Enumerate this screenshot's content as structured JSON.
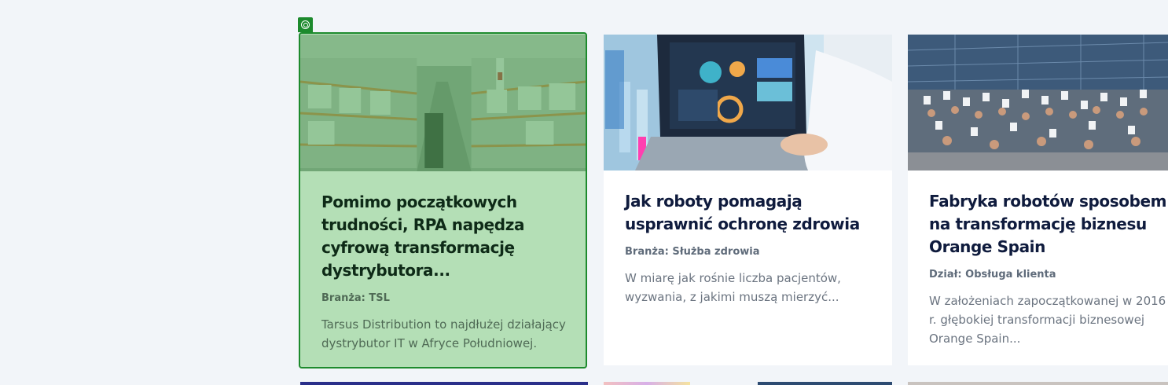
{
  "cards": [
    {
      "title": "Pomimo początkowych\ntrudności, RPA napędza\ncyfrową transformację\ndystrybutora...",
      "meta_label": "Branża:",
      "meta_value": "TSL",
      "excerpt": "Tarsus Distribution to najdłużej działający\ndystrybutor IT w Afryce Południowej.",
      "image": "warehouse-photo"
    },
    {
      "title": "Jak roboty pomagają\nusprawnić ochronę zdrowia",
      "meta_label": "Branża:",
      "meta_value": "Służba zdrowia",
      "excerpt": "W miarę jak rośnie liczba pacjentów,\nwyzwania, z jakimi muszą mierzyć...",
      "image": "laboratory-laptop-photo"
    },
    {
      "title": "Fabryka robotów sposobem\nna transformację biznesu\nOrange Spain",
      "meta_label": "Dział:",
      "meta_value": "Obsługa klienta",
      "excerpt": "W założeniach zapoczątkowanej w 2016\nr. głębokiej transformacji biznesowej\nOrange Spain...",
      "image": "group-photo"
    }
  ],
  "colors": {
    "accent": "#1d8a2d",
    "selected_bg": "#b4dfb6",
    "title": "#0f1b3d",
    "page_bg": "#f2f5f9"
  },
  "badge_icon": "target-icon"
}
